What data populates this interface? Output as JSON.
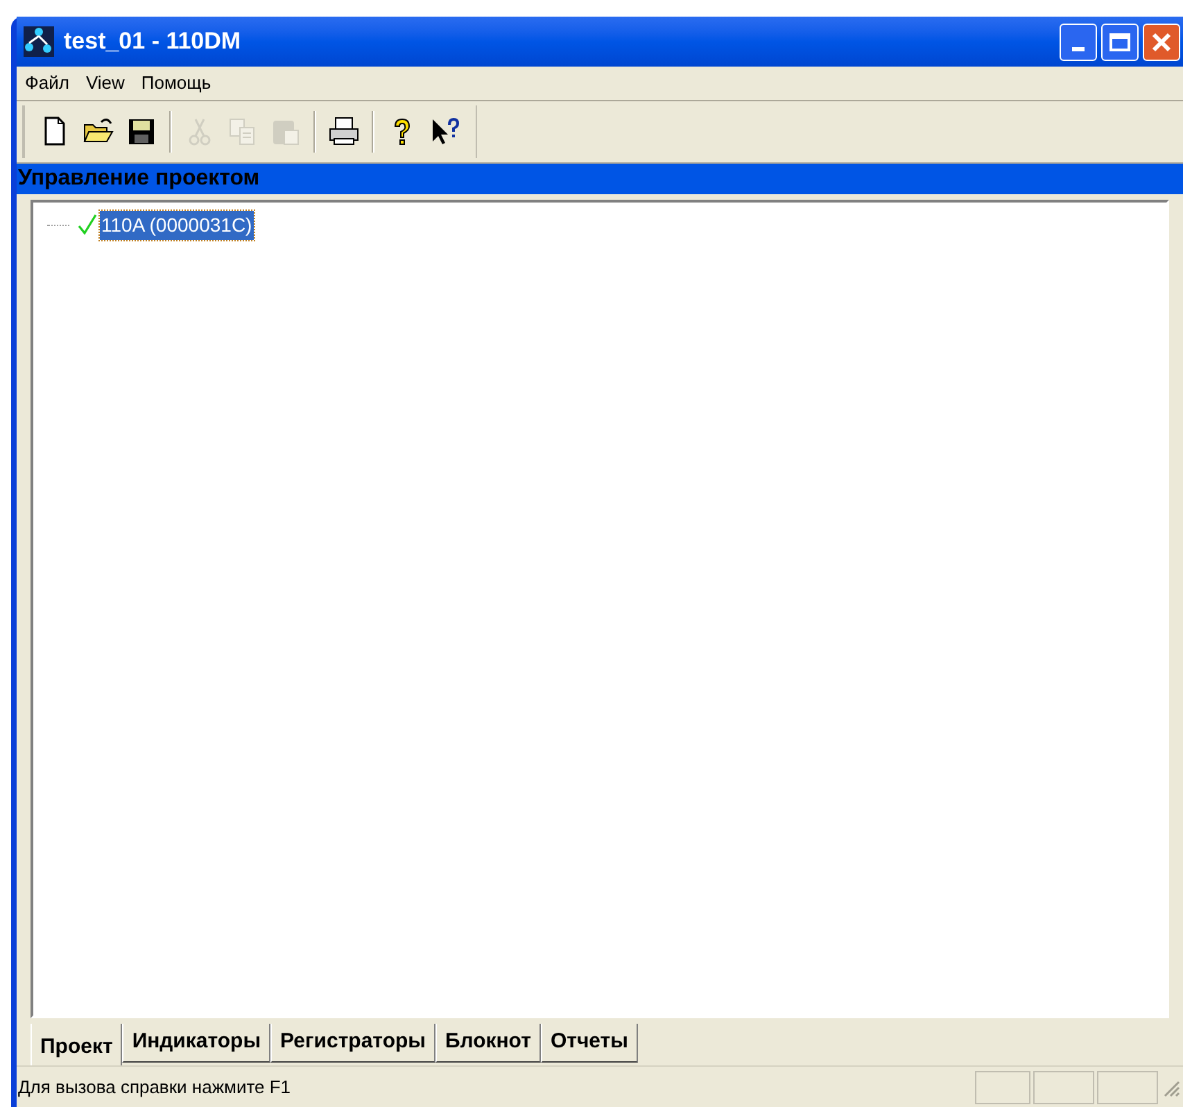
{
  "window": {
    "title": "test_01 - 110DM"
  },
  "menu": [
    "Файл",
    "View",
    "Помощь"
  ],
  "toolbar": [
    {
      "kind": "new",
      "disabled": false
    },
    {
      "kind": "open",
      "disabled": false
    },
    {
      "kind": "save",
      "disabled": false
    },
    {
      "kind": "sep"
    },
    {
      "kind": "cut",
      "disabled": true
    },
    {
      "kind": "copy",
      "disabled": true
    },
    {
      "kind": "paste",
      "disabled": true
    },
    {
      "kind": "sep"
    },
    {
      "kind": "print",
      "disabled": false
    },
    {
      "kind": "sep"
    },
    {
      "kind": "help",
      "disabled": false
    },
    {
      "kind": "context_help",
      "disabled": false
    }
  ],
  "panel": {
    "title": "Управление проектом"
  },
  "tree": [
    {
      "label": "110A (0000031C)",
      "checked": true,
      "selected": true
    }
  ],
  "tabs": [
    {
      "label": "Проект",
      "selected": true
    },
    {
      "label": "Индикаторы",
      "selected": false
    },
    {
      "label": "Регистраторы",
      "selected": false
    },
    {
      "label": "Блокнот",
      "selected": false
    },
    {
      "label": "Отчеты",
      "selected": false
    }
  ],
  "status_bar": {
    "text": "Для вызова справки нажмите F1"
  }
}
